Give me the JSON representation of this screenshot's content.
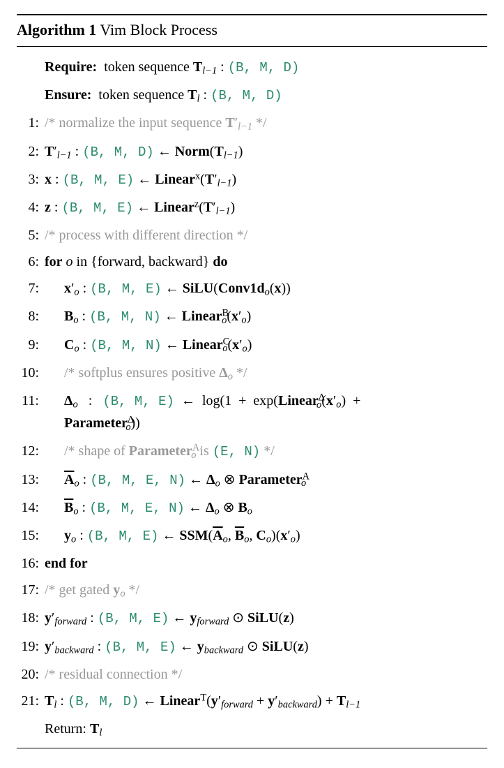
{
  "algorithm": {
    "number": "Algorithm 1",
    "title": "Vim Block Process",
    "require_label": "Require:",
    "ensure_label": "Ensure:",
    "return_label": "Return:",
    "require_text": "token sequence ",
    "require_sym": "T",
    "require_sub": "l−1",
    "require_dims": "(B, M, D)",
    "ensure_text": "token sequence ",
    "ensure_sym": "T",
    "ensure_sub": "l",
    "ensure_dims": "(B, M, D)",
    "return_sym": "T",
    "return_sub": "l",
    "lines": {
      "l1_comment_pre": "/* normalize the input sequence ",
      "l1_comment_post": " */",
      "l2_dims": "(B, M, D)",
      "l3_dims": "(B, M, E)",
      "l4_dims": "(B, M, E)",
      "l5_comment": "/* process with different direction */",
      "l6_for": "for",
      "l6_in": "in",
      "l6_set": "{forward, backward}",
      "l6_do": "do",
      "l7_dims": "(B, M, E)",
      "l8_dims": "(B, M, N)",
      "l9_dims": "(B, M, N)",
      "l10_comment_pre": "/* softplus ensures positive ",
      "l10_comment_post": " */",
      "l11_dims": "(B, M, E)",
      "l12_comment_pre": "/* shape of ",
      "l12_comment_post": " is ",
      "l12_dims": "(E, N)",
      "l12_end": " */",
      "l13_dims": "(B, M, E, N)",
      "l14_dims": "(B, M, E, N)",
      "l15_dims": "(B, M, E)",
      "l16_endfor": "end for",
      "l17_comment_pre": "/* get gated ",
      "l17_comment_post": " */",
      "l18_dims": "(B, M, E)",
      "l19_dims": "(B, M, E)",
      "l20_comment": "/* residual connection */",
      "l21_dims": "(B, M, D)"
    }
  }
}
